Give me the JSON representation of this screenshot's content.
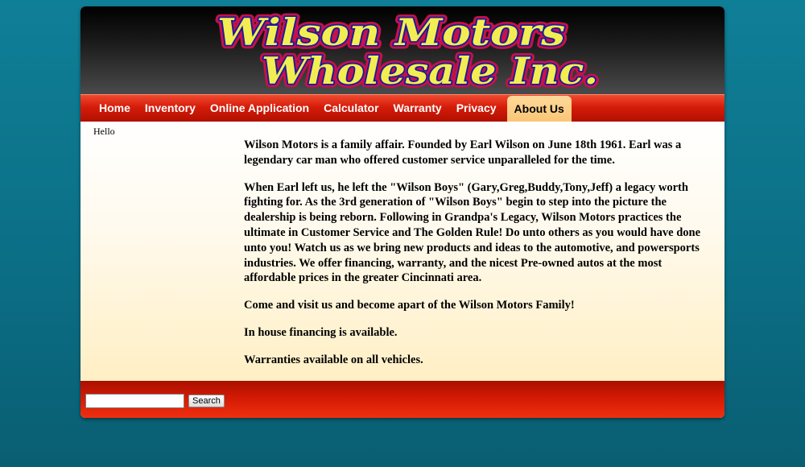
{
  "logo": {
    "line1": "Wilson Motors",
    "line2": "Wholesale Inc."
  },
  "nav": {
    "items": [
      {
        "label": "Home"
      },
      {
        "label": "Inventory"
      },
      {
        "label": "Online Application"
      },
      {
        "label": "Calculator"
      },
      {
        "label": "Warranty"
      },
      {
        "label": "Privacy"
      },
      {
        "label": "About Us",
        "active": true
      }
    ]
  },
  "sidebar": {
    "text": "Hello"
  },
  "main": {
    "paragraphs": [
      "Wilson Motors is a family affair. Founded by Earl Wilson on June 18th 1961. Earl was a legendary car man who offered customer service unparalleled for the time.",
      "When Earl left us, he left the \"Wilson Boys\" (Gary,Greg,Buddy,Tony,Jeff) a legacy worth fighting for. As the 3rd generation of \"Wilson Boys\" begin to step into the picture the dealership is being reborn. Following in Grandpa's Legacy, Wilson Motors practices the ultimate in Customer Service and The Golden Rule! Do unto others as you would have done unto you! Watch us as we bring new products and ideas to the automotive, and powersports industries. We offer financing, warranty, and the nicest Pre-owned autos at the most affordable prices in the greater Cincinnati area.",
      "Come and visit us and become apart of the Wilson Motors Family!",
      "In house financing is available.",
      "Warranties available on all vehicles."
    ]
  },
  "footer": {
    "search_value": "",
    "search_button_label": "Search"
  },
  "colors": {
    "logo_fill": "#f2ee52",
    "logo_inner_stroke": "#1a1a9a",
    "logo_outer_stroke": "#c4124a",
    "nav_active_bg": "#fcd088",
    "nav_bg": "#d61c0a"
  }
}
